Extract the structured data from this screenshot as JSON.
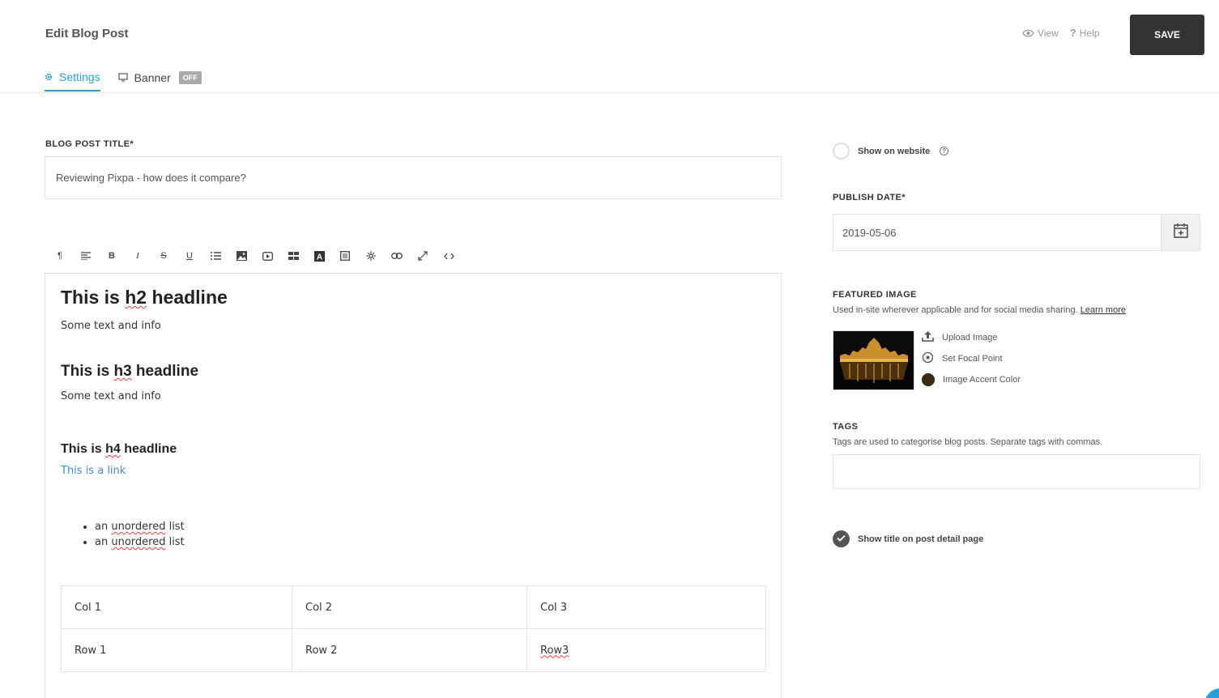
{
  "header": {
    "title": "Edit Blog Post",
    "view_label": "View",
    "help_label": "Help",
    "save_label": "SAVE"
  },
  "tabs": [
    {
      "label": "Settings",
      "icon": "gear-icon",
      "active": true
    },
    {
      "label": "Banner",
      "icon": "monitor-icon",
      "badge": "OFF"
    }
  ],
  "form": {
    "title_label": "BLOG POST TITLE*",
    "title_value": "Reviewing Pixpa - how does it compare?"
  },
  "toolbar": [
    "paragraph-icon",
    "align-icon",
    "bold-icon",
    "italic-icon",
    "strikethrough-icon",
    "underline-icon",
    "list-icon",
    "image-icon",
    "video-icon",
    "table-icon",
    "font-color-icon",
    "block-icon",
    "widget-icon",
    "link-icon",
    "fullscreen-icon",
    "code-icon"
  ],
  "editor": {
    "h2": {
      "pre": "This is ",
      "word": "h2",
      "post": " headline"
    },
    "p1": "Some text and info",
    "h3": {
      "pre": "This is ",
      "word": "h3",
      "post": " headline"
    },
    "p2": "Some text and info",
    "h4": {
      "pre": "This is ",
      "word": "h4",
      "post": " headline"
    },
    "link": "This is a link",
    "list": [
      {
        "pre": "an ",
        "word": "unordered",
        "post": " list"
      },
      {
        "pre": "an ",
        "word": "unordered",
        "post": " list"
      }
    ],
    "table": [
      [
        "Col 1",
        "Col 2",
        "Col 3"
      ],
      [
        "Row 1",
        "Row 2",
        "Row3"
      ]
    ]
  },
  "sidebar": {
    "show_on_website": "Show on website",
    "help_glyph": "?",
    "publish_label": "PUBLISH DATE*",
    "publish_value": "2019-05-06",
    "featured_label": "FEATURED IMAGE",
    "featured_desc": "Used in-site wherever applicable and for social media sharing.",
    "learn_more": "Learn more",
    "upload_image": "Upload Image",
    "set_focal_point": "Set Focal Point",
    "image_accent_color": "Image Accent Color",
    "accent_color": "#3d2a12",
    "tags_label": "TAGS",
    "tags_desc": "Tags are used to categorise blog posts. Separate tags with commas.",
    "tags_value": "",
    "show_title": "Show title on post detail page",
    "show_title_checked": true
  },
  "colors": {
    "accent": "#2a9fd6",
    "save_bg": "#333333"
  }
}
